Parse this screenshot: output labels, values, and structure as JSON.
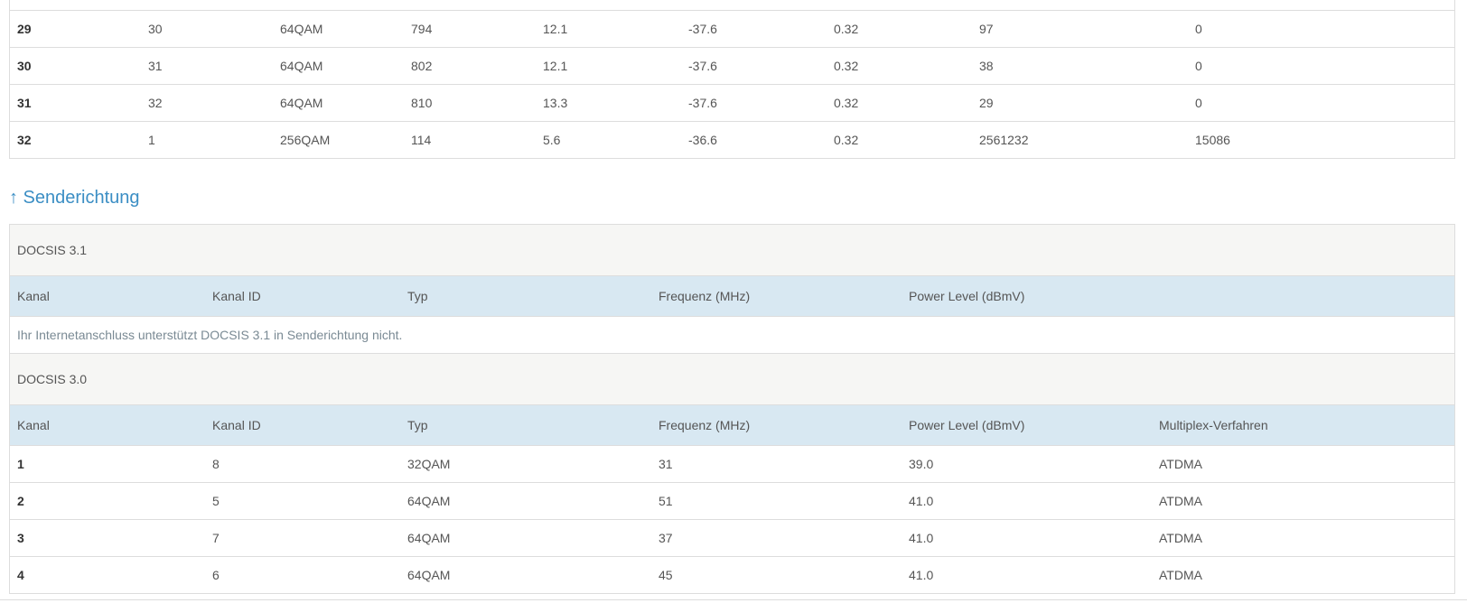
{
  "downstream": {
    "rows": [
      {
        "kanal": "29",
        "kanal_id": "30",
        "typ": "64QAM",
        "frequenz": "794",
        "mer": "12.1",
        "power": "-37.6",
        "latenz": "0.32",
        "corr": "97",
        "uncorr": "0"
      },
      {
        "kanal": "30",
        "kanal_id": "31",
        "typ": "64QAM",
        "frequenz": "802",
        "mer": "12.1",
        "power": "-37.6",
        "latenz": "0.32",
        "corr": "38",
        "uncorr": "0"
      },
      {
        "kanal": "31",
        "kanal_id": "32",
        "typ": "64QAM",
        "frequenz": "810",
        "mer": "13.3",
        "power": "-37.6",
        "latenz": "0.32",
        "corr": "29",
        "uncorr": "0"
      },
      {
        "kanal": "32",
        "kanal_id": "1",
        "typ": "256QAM",
        "frequenz": "114",
        "mer": "5.6",
        "power": "-36.6",
        "latenz": "0.32",
        "corr": "2561232",
        "uncorr": "15086"
      }
    ]
  },
  "upstream": {
    "heading": "↑ Senderichtung",
    "docsis31": {
      "title": "DOCSIS 3.1",
      "headers": [
        "Kanal",
        "Kanal ID",
        "Typ",
        "Frequenz (MHz)",
        "Power Level (dBmV)"
      ],
      "message": "Ihr Internetanschluss unterstützt DOCSIS 3.1 in Senderichtung nicht."
    },
    "docsis30": {
      "title": "DOCSIS 3.0",
      "headers": [
        "Kanal",
        "Kanal ID",
        "Typ",
        "Frequenz (MHz)",
        "Power Level (dBmV)",
        "Multiplex-Verfahren"
      ],
      "rows": [
        {
          "kanal": "1",
          "kanal_id": "8",
          "typ": "32QAM",
          "frequenz": "31",
          "power": "39.0",
          "multiplex": "ATDMA"
        },
        {
          "kanal": "2",
          "kanal_id": "5",
          "typ": "64QAM",
          "frequenz": "51",
          "power": "41.0",
          "multiplex": "ATDMA"
        },
        {
          "kanal": "3",
          "kanal_id": "7",
          "typ": "64QAM",
          "frequenz": "37",
          "power": "41.0",
          "multiplex": "ATDMA"
        },
        {
          "kanal": "4",
          "kanal_id": "6",
          "typ": "64QAM",
          "frequenz": "45",
          "power": "41.0",
          "multiplex": "ATDMA"
        }
      ]
    }
  },
  "colors": {
    "heading": "#3b8ec4",
    "header_bg": "#d8e8f2",
    "section_bg": "#f6f6f4"
  }
}
